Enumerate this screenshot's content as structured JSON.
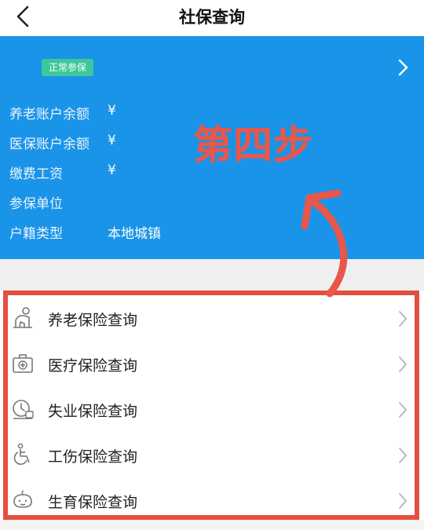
{
  "header": {
    "title": "社保查询"
  },
  "card": {
    "badge": "正常参保",
    "rows": [
      {
        "label": "养老账户余额",
        "value": "¥"
      },
      {
        "label": "医保账户余额",
        "value": "¥"
      },
      {
        "label": "缴费工资",
        "value": "¥"
      },
      {
        "label": "参保单位",
        "value": ""
      },
      {
        "label": "户籍类型",
        "value": "本地城镇"
      }
    ]
  },
  "annotation": {
    "step_text": "第四步",
    "color": "#e8574a"
  },
  "menu": {
    "items": [
      {
        "label": "养老保险查询",
        "icon": "elderly-person-icon"
      },
      {
        "label": "医疗保险查询",
        "icon": "medical-kit-icon"
      },
      {
        "label": "失业保险查询",
        "icon": "unemployment-clock-icon"
      },
      {
        "label": "工伤保险查询",
        "icon": "wheelchair-icon"
      },
      {
        "label": "生育保险查询",
        "icon": "baby-icon"
      }
    ]
  },
  "colors": {
    "card_bg": "#1a94e8",
    "badge_bg": "#3ec79b",
    "highlight_border": "#e44e3f"
  }
}
